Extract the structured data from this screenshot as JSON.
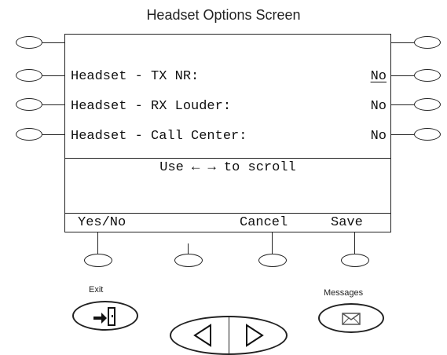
{
  "screen": {
    "title": "Headset Options Screen"
  },
  "options": [
    {
      "label": "Headset - TX NR:",
      "value": "No",
      "selected": true
    },
    {
      "label": "Headset - RX Louder:",
      "value": "No",
      "selected": false
    },
    {
      "label": "Headset - Call Center:",
      "value": "No",
      "selected": false
    }
  ],
  "hint": {
    "text": "Use ← → to scroll"
  },
  "softkeys": {
    "key1": "Yes/No",
    "key2": "",
    "key3": "Cancel",
    "key4": "Save"
  },
  "hardkeys": {
    "exit_label": "Exit",
    "messages_label": "Messages"
  },
  "icons": {
    "exit": "exit-door-icon",
    "messages": "envelope-icon",
    "left": "left-triangle-icon",
    "right": "right-triangle-icon"
  }
}
